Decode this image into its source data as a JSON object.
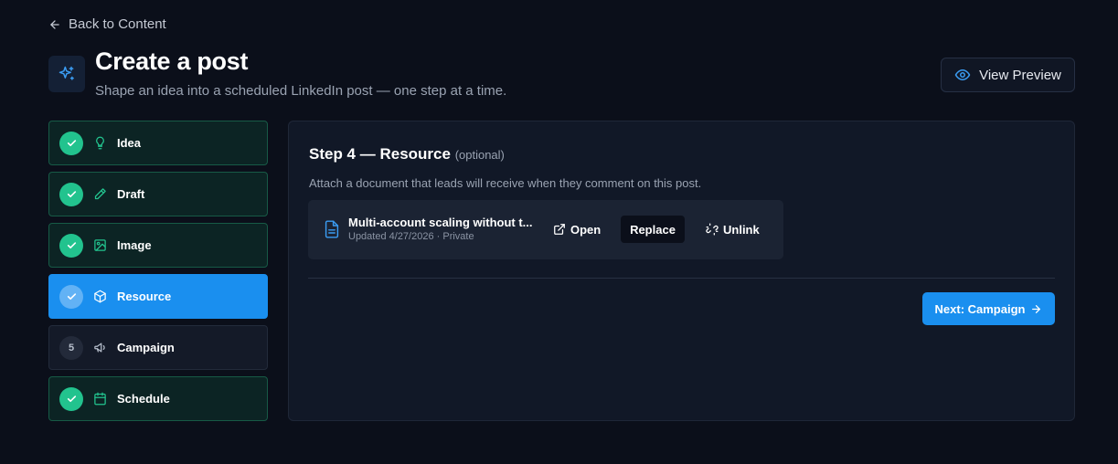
{
  "back_link": {
    "label": "Back to Content",
    "icon": "arrow-left-icon"
  },
  "header": {
    "icon": "sparkles-icon",
    "title": "Create a post",
    "subtitle": "Shape an idea into a scheduled LinkedIn post — one step at a time.",
    "preview_button": {
      "label": "View Preview",
      "icon": "eye-icon"
    }
  },
  "steps": [
    {
      "label": "Idea",
      "status": "done",
      "icon": "lightbulb-icon"
    },
    {
      "label": "Draft",
      "status": "done",
      "icon": "pencil-icon"
    },
    {
      "label": "Image",
      "status": "done",
      "icon": "image-icon"
    },
    {
      "label": "Resource",
      "status": "active",
      "icon": "package-icon"
    },
    {
      "label": "Campaign",
      "status": "pending",
      "number": "5",
      "icon": "megaphone-icon"
    },
    {
      "label": "Schedule",
      "status": "done",
      "icon": "calendar-icon"
    }
  ],
  "panel": {
    "heading": "Step 4 — Resource",
    "heading_suffix": "(optional)",
    "description": "Attach a document that leads will receive when they comment on this post.",
    "resource": {
      "icon": "document-icon",
      "title": "Multi-account scaling without t...",
      "meta": "Updated 4/27/2026 · Private",
      "open_label": "Open",
      "replace_label": "Replace",
      "unlink_label": "Unlink"
    },
    "next_button": {
      "label": "Next: Campaign",
      "icon": "arrow-right-icon"
    }
  },
  "colors": {
    "background": "#0b0f1a",
    "accent": "#1a8fef",
    "success": "#22c38e",
    "panel": "#111827"
  }
}
